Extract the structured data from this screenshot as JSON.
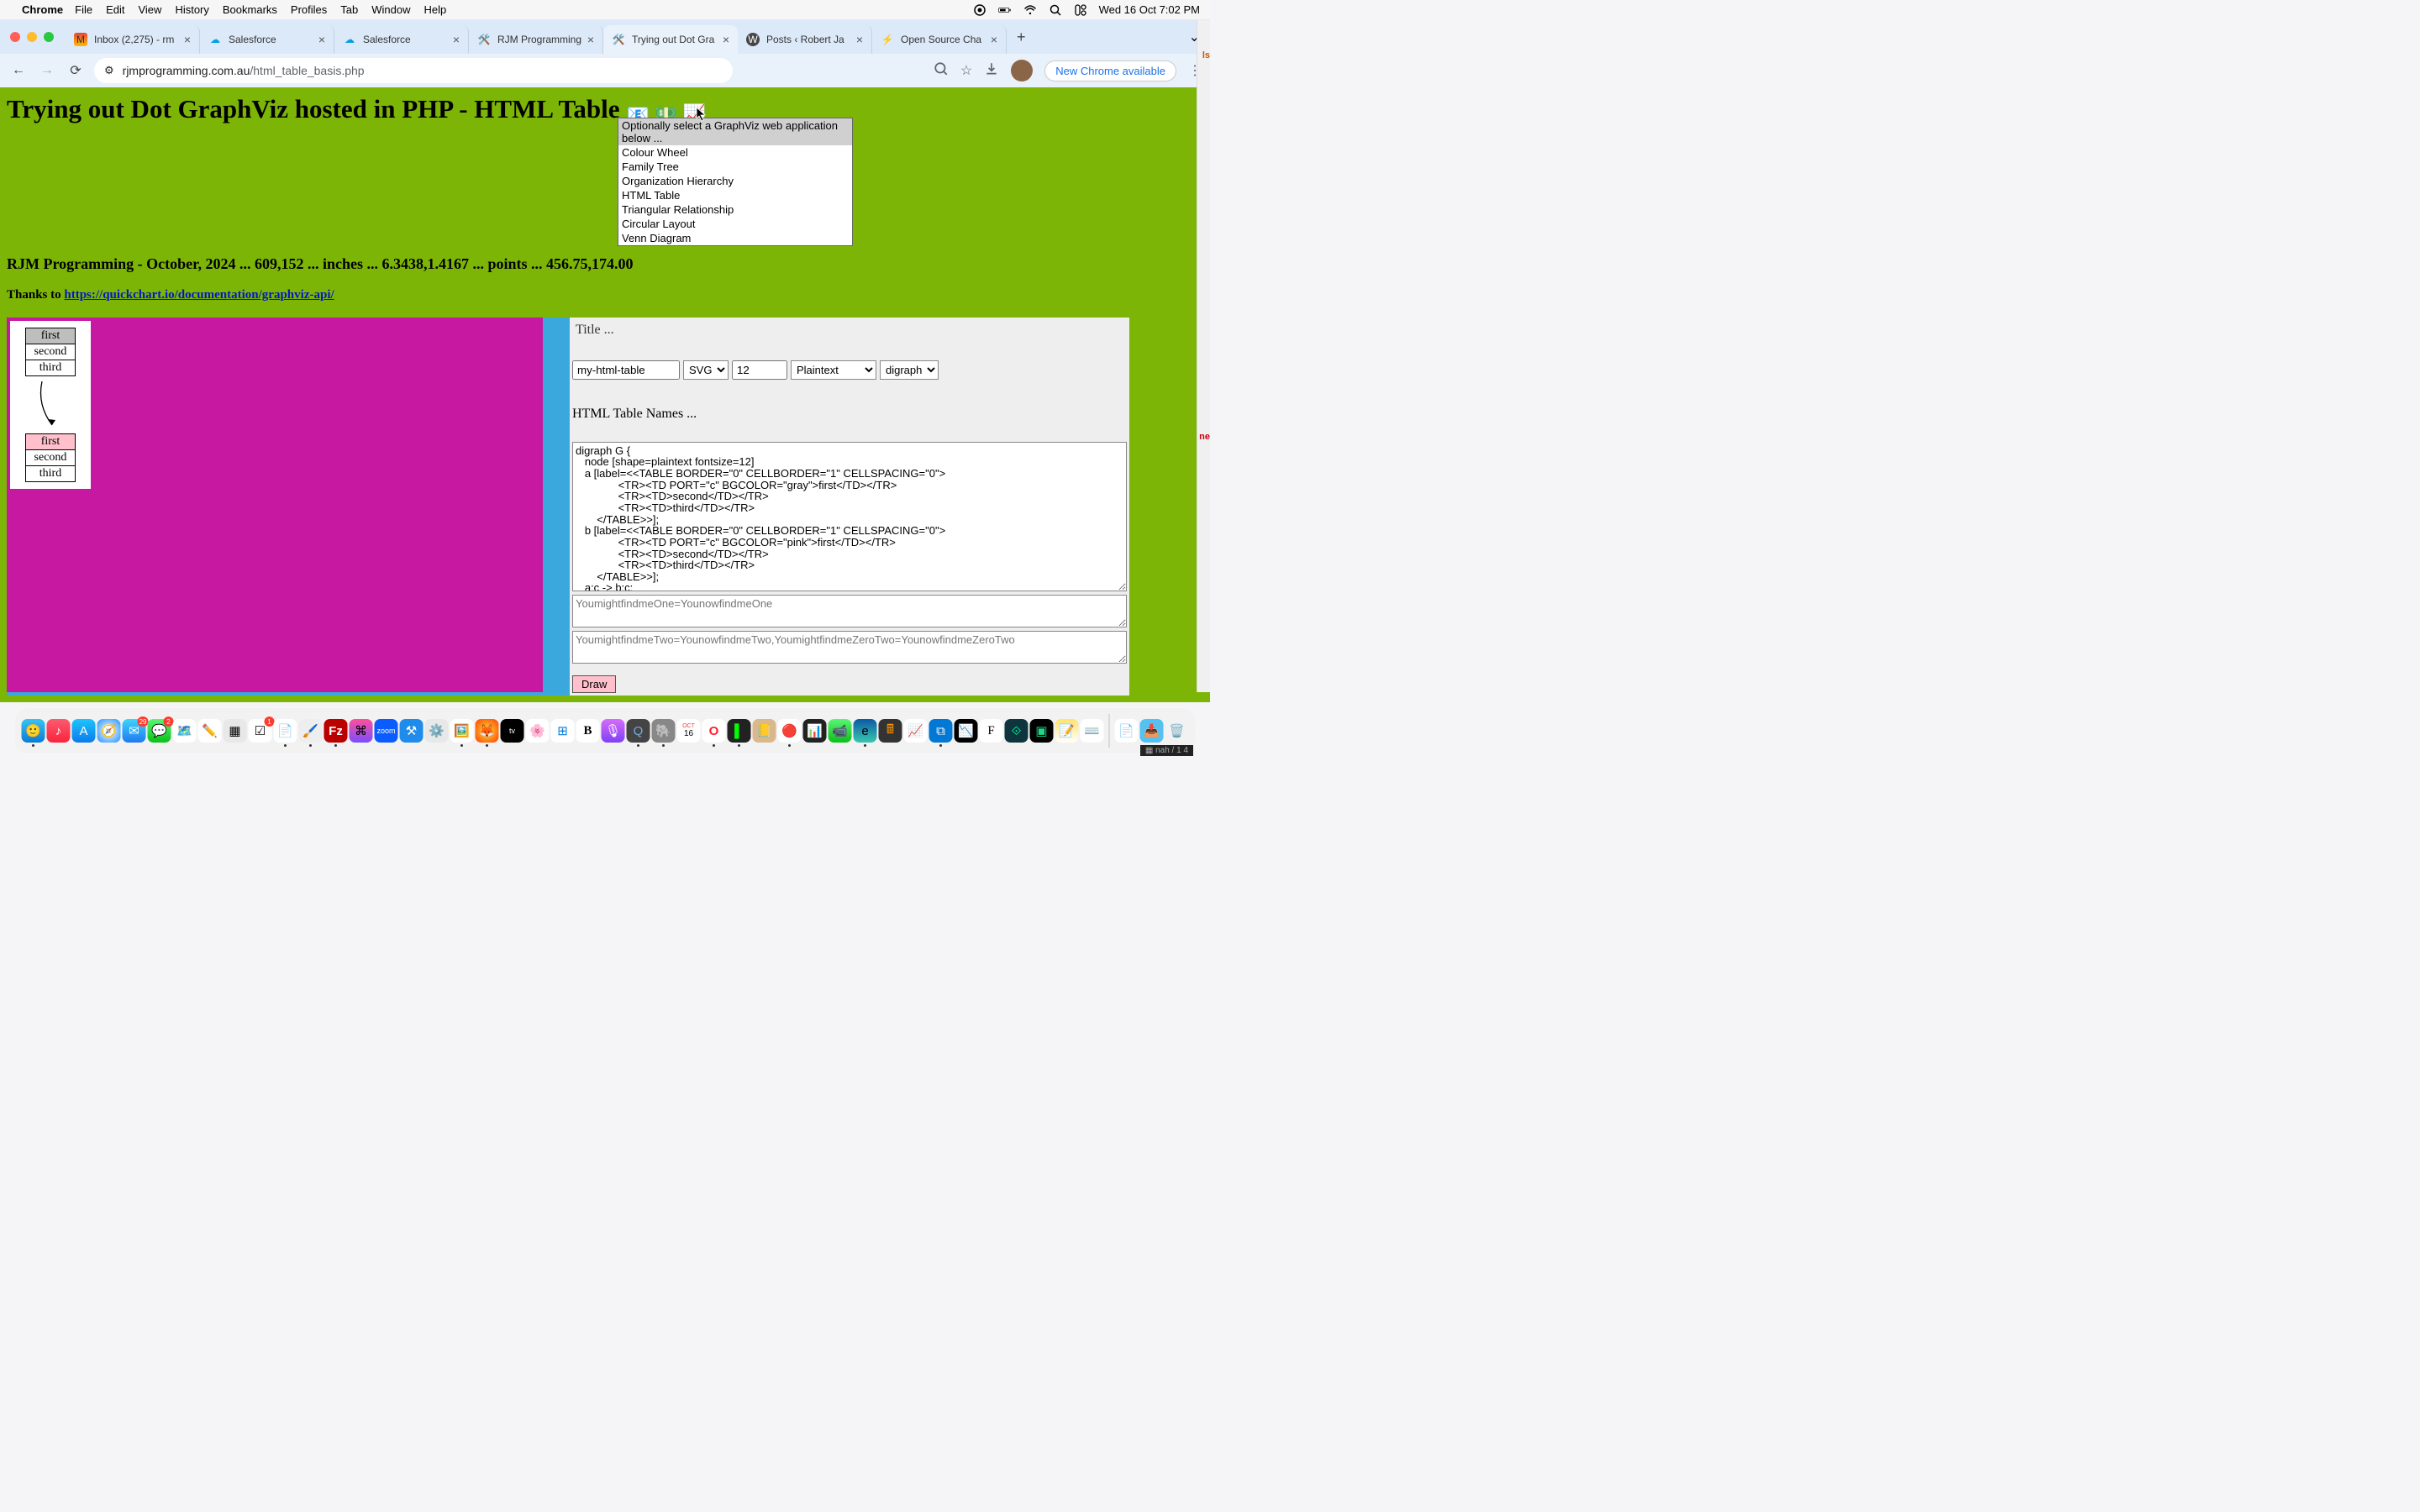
{
  "menubar": {
    "app": "Chrome",
    "items": [
      "File",
      "Edit",
      "View",
      "History",
      "Bookmarks",
      "Profiles",
      "Tab",
      "Window",
      "Help"
    ],
    "datetime": "Wed 16 Oct  7:02 PM"
  },
  "tabs": [
    {
      "title": "Inbox (2,275) - rm",
      "favicon": "gmail"
    },
    {
      "title": "Salesforce",
      "favicon": "salesforce"
    },
    {
      "title": "Salesforce",
      "favicon": "salesforce"
    },
    {
      "title": "RJM Programming",
      "favicon": "rjm"
    },
    {
      "title": "Trying out Dot Gra",
      "favicon": "rjm",
      "active": true
    },
    {
      "title": "Posts ‹ Robert Ja",
      "favicon": "wp"
    },
    {
      "title": "Open Source Cha",
      "favicon": "bolt"
    }
  ],
  "url": {
    "domain": "rjmprogramming.com.au",
    "path": "/html_table_basis.php"
  },
  "chrome_chip": "New Chrome available",
  "page": {
    "h1": "Trying out Dot GraphViz hosted in PHP - HTML Table",
    "dropdown": {
      "placeholder": "Optionally select a GraphViz web application below ...",
      "options": [
        "Colour Wheel",
        "Family Tree",
        "Organization Hierarchy",
        "HTML Table",
        "Triangular Relationship",
        "Circular Layout",
        "Venn Diagram"
      ]
    },
    "subtitle": "RJM Programming - October, 2024 ... 609,152 ... inches ... 6.3438,1.4167 ... points ... 456.75,174.00",
    "thanks_prefix": "Thanks to ",
    "thanks_link": "https://quickchart.io/documentation/graphviz-api/",
    "svg": {
      "node_a": [
        "first",
        "second",
        "third"
      ],
      "node_b": [
        "first",
        "second",
        "third"
      ]
    },
    "title_placeholder": "Title ...",
    "controls": {
      "name": "my-html-table",
      "format": "SVG",
      "fontsize": "12",
      "shape": "Plaintext",
      "engine": "digraph"
    },
    "names_label": "HTML Table Names ...",
    "code": "digraph G {\n   node [shape=plaintext fontsize=12]\n   a [label=<<TABLE BORDER=\"0\" CELLBORDER=\"1\" CELLSPACING=\"0\">\n              <TR><TD PORT=\"c\" BGCOLOR=\"gray\">first</TD></TR>\n              <TR><TD>second</TD></TR>\n              <TR><TD>third</TD></TR>\n       </TABLE>>];\n   b [label=<<TABLE BORDER=\"0\" CELLBORDER=\"1\" CELLSPACING=\"0\">\n              <TR><TD PORT=\"c\" BGCOLOR=\"pink\">first</TD></TR>\n              <TR><TD>second</TD></TR>\n              <TR><TD>third</TD></TR>\n       </TABLE>>];\n   a:c -> b:c;\n}",
    "placeholder1": "YoumightfindmeOne=YounowfindmeOne",
    "placeholder2": "YoumightfindmeTwo=YounowfindmeTwo,YoumightfindmeZeroTwo=YounowfindmeZeroTwo",
    "draw": "Draw"
  },
  "rightslice": {
    "t1": "ls",
    "t2": "ne"
  },
  "footer": "nah / 1 4"
}
